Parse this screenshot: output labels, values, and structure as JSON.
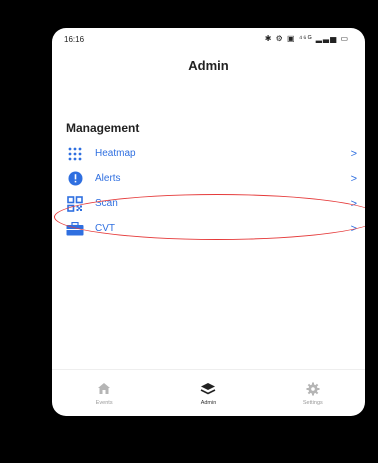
{
  "status_bar": {
    "time": "16:16",
    "indicators": "✱ ⚙ ▣ ⁴⁶ᴳ ▂▃▅ ▭"
  },
  "header": {
    "title": "Admin"
  },
  "section": {
    "title": "Management"
  },
  "menu": [
    {
      "label": "Heatmap",
      "icon": "grid-dots-icon",
      "chevron": ">"
    },
    {
      "label": "Alerts",
      "icon": "alert-circle-icon",
      "chevron": ">"
    },
    {
      "label": "Scan",
      "icon": "qr-scan-icon",
      "chevron": ">"
    },
    {
      "label": "CVT",
      "icon": "briefcase-icon",
      "chevron": ">"
    }
  ],
  "tabs": [
    {
      "label": "Events",
      "icon": "home-icon",
      "active": false
    },
    {
      "label": "Admin",
      "icon": "layers-icon",
      "active": true
    },
    {
      "label": "Settings",
      "icon": "gear-icon",
      "active": false
    }
  ],
  "colors": {
    "accent": "#2f6fe0",
    "highlight": "#e53a3a"
  }
}
